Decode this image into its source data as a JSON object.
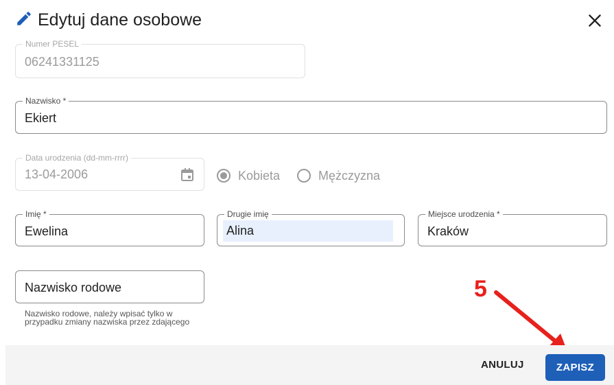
{
  "dialog": {
    "title": "Edytuj dane osobowe",
    "icon": "pencil-icon",
    "close_icon": "close-icon"
  },
  "fields": {
    "pesel": {
      "label": "Numer PESEL",
      "value": "06241331125",
      "disabled": true
    },
    "surname": {
      "label": "Nazwisko *",
      "value": "Ekiert"
    },
    "birth_date": {
      "label": "Data urodzenia (dd-mm-rrrr)",
      "value": "13-04-2006",
      "disabled": true,
      "icon": "calendar-icon"
    },
    "first_name": {
      "label": "Imię *",
      "value": "Ewelina"
    },
    "second_name": {
      "label": "Drugie imię",
      "value": "Alina"
    },
    "birth_place": {
      "label": "Miejsce urodzenia *",
      "value": "Kraków"
    },
    "family_name": {
      "placeholder": "Nazwisko rodowe",
      "helper": "Nazwisko rodowe, należy wpisać tylko w przypadku zmiany nazwiska przez zdającego"
    }
  },
  "gender": {
    "options": [
      {
        "label": "Kobieta",
        "selected": true
      },
      {
        "label": "Mężczyzna",
        "selected": false
      }
    ],
    "disabled": true
  },
  "footer": {
    "cancel_label": "ANULUJ",
    "save_label": "ZAPISZ"
  },
  "annotation": {
    "step_number": "5",
    "color": "#e8211c"
  },
  "colors": {
    "primary": "#1e5fb8",
    "autofill": "#e8f0fe",
    "footer_bg": "#f4f4f4"
  }
}
